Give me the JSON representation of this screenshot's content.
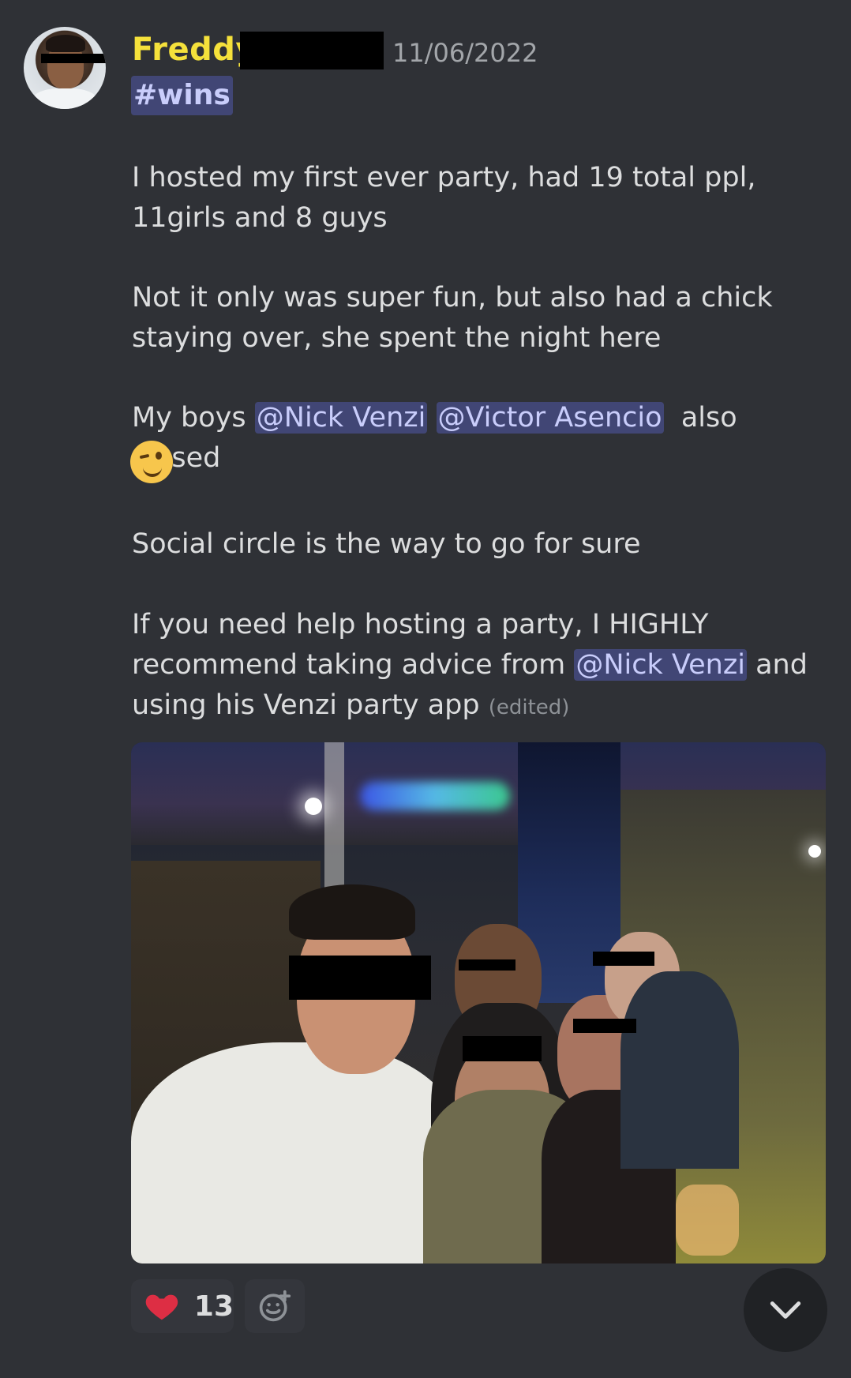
{
  "message": {
    "username": "Freddy",
    "timestamp": "11/06/2022",
    "channel_tag": "#wins",
    "p1": "I hosted my first ever party, had 19 total ppl, 11girls and 8 guys",
    "p2": "Not it only was super fun, but also had a chick staying over, she spent the night here",
    "p3_prefix": "My boys",
    "mention_nick": "@Nick Venzi",
    "mention_victor": "@Victor Asencio",
    "p3_suffix": "also closed",
    "p4": "Social circle is the way to go for sure",
    "p5_prefix": "If you need help hosting a party, I HIGHLY recommend taking advice from",
    "p5_suffix": "and using his Venzi party app",
    "edited": "(edited)"
  },
  "reactions": [
    {
      "emoji": "heart-icon",
      "count": "13"
    }
  ],
  "colors": {
    "background": "#2f3136",
    "username": "#f5e13b",
    "mention_bg": "#414675",
    "mention_text": "#c9cdfb",
    "heart": "#dd2e44"
  }
}
